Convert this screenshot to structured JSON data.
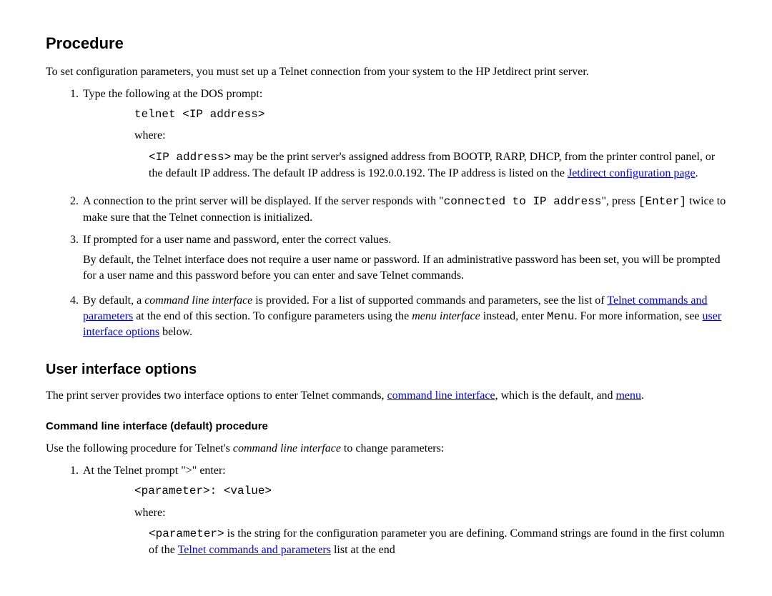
{
  "procedure": {
    "heading": "Procedure",
    "intro": "To set configuration parameters, you must set up a Telnet connection from your system to the HP Jetdirect print server.",
    "step1_num": "1.",
    "step1_text": "Type the following at the DOS prompt:",
    "step1_code": "telnet <IP address>",
    "step1_where": "where:",
    "step1_detail_code": "<IP address>",
    "step1_detail_a": " may be the print server's assigned address from BOOTP, RARP, DHCP, from the printer control panel, or the default IP address. The default IP address is 192.0.0.192. The IP address is listed on the ",
    "step1_link": "Jetdirect configuration page",
    "step1_period": ".",
    "step2_num": "2.",
    "step2_a": "A connection to the print server will be displayed. If the server responds with \"",
    "step2_code1": "connected to IP address",
    "step2_b": "\", press ",
    "step2_code2": "[Enter]",
    "step2_c": " twice to make sure that the Telnet connection is initialized.",
    "step3_num": "3.",
    "step3_a": "If prompted for a user name and password, enter the correct values.",
    "step3_b": "By default, the Telnet interface does not require a user name or password. If an administrative password has been set, you will be prompted for a user name and this password before you can enter and save Telnet commands.",
    "step4_num": "4.",
    "step4_a": "By default, a ",
    "step4_i1": "command line interface",
    "step4_b": " is provided. For a list of supported commands and parameters, see the list of ",
    "step4_link1": "Telnet commands and parameters",
    "step4_c": " at the end of this section. To configure parameters using the ",
    "step4_i2": "menu interface",
    "step4_d": " instead, enter ",
    "step4_code": "Menu",
    "step4_e": ". For more information, see ",
    "step4_link2": "user interface options",
    "step4_f": " below."
  },
  "uio": {
    "heading": "User interface options",
    "intro_a": "The print server provides two interface options to enter Telnet commands, ",
    "link_cli": "command line interface",
    "intro_b": ", which is the default, and ",
    "link_menu": "menu",
    "intro_c": ".",
    "sub_heading": "Command line interface (default) procedure",
    "sub_intro_a": "Use the following procedure for Telnet's ",
    "sub_intro_i": "command line interface",
    "sub_intro_b": " to change parameters:",
    "s1_num": "1.",
    "s1_text": "At the Telnet prompt \">\" enter:",
    "s1_code": "<parameter>: <value>",
    "s1_where": "where:",
    "s1_detail_code": "<parameter>",
    "s1_detail_a": " is the string for the configuration parameter you are defining. Command strings are found in the first column of the ",
    "s1_link": "Telnet commands and parameters",
    "s1_detail_b": " list at the end"
  }
}
